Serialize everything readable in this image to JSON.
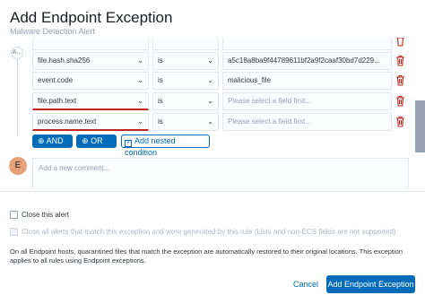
{
  "header": {
    "title": "Add Endpoint Exception",
    "subtitle": "Malware Detection Alert"
  },
  "conditions": [
    {
      "field": "",
      "operator": "",
      "value": "",
      "value_is_placeholder": false
    },
    {
      "field": "file.hash.sha256",
      "operator": "is",
      "value": "a5c18a8ba9f44789611bf2a9f2caaf30bd7d229...",
      "value_is_placeholder": false
    },
    {
      "field": "event.code",
      "operator": "is",
      "value": "malicious_file",
      "value_is_placeholder": false
    },
    {
      "field": "file.path.text",
      "operator": "is",
      "value": "Please select a field first...",
      "value_is_placeholder": true
    },
    {
      "field": "process.name.text",
      "operator": "is",
      "value": "Please select a field first...",
      "value_is_placeholder": true
    }
  ],
  "group_toggle": "A...",
  "buttons": {
    "and": "AND",
    "or": "OR",
    "nested": "Add nested condition",
    "cancel": "Cancel",
    "submit": "Add Endpoint Exception"
  },
  "comment": {
    "avatar": "E",
    "placeholder": "Add a new comment..."
  },
  "options": {
    "close_alert": "Close this alert",
    "close_all": "Close all alerts that match this exception and were generated by this rule (Lists and non-ECS fields are not supported)"
  },
  "info_text": "On all Endpoint hosts, quarantined files that match the exception are automatically restored to their original locations. This exception applies to all rules using Endpoint exceptions.",
  "colors": {
    "primary": "#006bb8",
    "danger": "#bd271e",
    "avatar": "#e7a27a"
  }
}
